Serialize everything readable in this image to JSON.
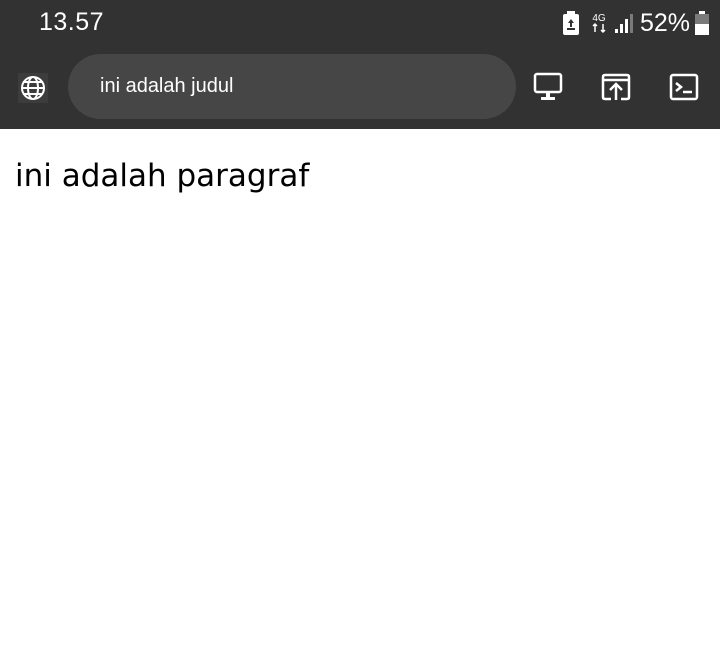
{
  "status_bar": {
    "time": "13.57",
    "network": "4G",
    "battery_percent": "52%"
  },
  "toolbar": {
    "url_text": "ini adalah judul",
    "icons": [
      "globe-icon",
      "desktop-icon",
      "open-external-icon",
      "terminal-icon"
    ]
  },
  "page": {
    "paragraph": "ini adalah paragraf"
  },
  "colors": {
    "chrome_bg": "#323232",
    "urlbar_bg": "#464646",
    "page_bg": "#ffffff",
    "text_light": "#ffffff",
    "text_dark": "#000000"
  }
}
